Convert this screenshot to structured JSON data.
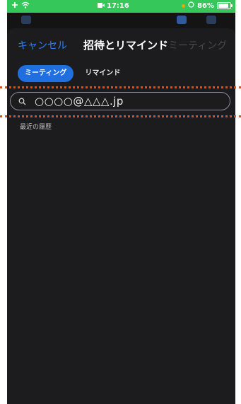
{
  "statusbar": {
    "time": "17:16",
    "battery": "86%",
    "battery_level": 0.86
  },
  "nav": {
    "cancel": "キャンセル",
    "title": "招待とリマインド",
    "next": "ミーティング"
  },
  "tabs": [
    {
      "label": "ミーティング",
      "active": true
    },
    {
      "label": "リマインド",
      "active": false
    }
  ],
  "search": {
    "value": "○○○○@△△△.jp",
    "icon": "search-icon"
  },
  "section": {
    "recent_history": "最近の履歴"
  },
  "colors": {
    "accent": "#1f6fe0",
    "link": "#2d7ff9",
    "statusbar": "#35c759",
    "highlight": "#d4521c"
  }
}
